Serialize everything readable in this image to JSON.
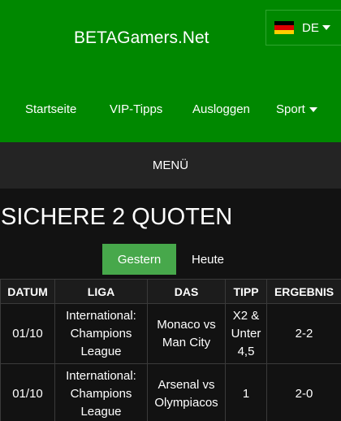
{
  "site": {
    "title": "BETAGamers.Net"
  },
  "language": {
    "code": "DE",
    "flag_colors": [
      "#000000",
      "#dd0000",
      "#ffce00"
    ]
  },
  "nav": {
    "items": [
      "Startseite",
      "VIP-Tipps",
      "Ausloggen",
      "Sport"
    ]
  },
  "menu": {
    "label": "MENÜ"
  },
  "page": {
    "title": "SICHERE 2 QUOTEN"
  },
  "tabs": [
    {
      "label": "Gestern",
      "active": true
    },
    {
      "label": "Heute",
      "active": false
    }
  ],
  "table": {
    "headers": [
      "DATUM",
      "LIGA",
      "DAS",
      "TIPP",
      "ERGEBNIS"
    ],
    "rows": [
      [
        "01/10",
        "International: Champions League",
        "Monaco vs Man City",
        "X2 & Unter 4,5",
        "2-2"
      ],
      [
        "01/10",
        "International: Champions League",
        "Arsenal vs Olympiacos",
        "1",
        "2-0"
      ]
    ]
  },
  "colors": {
    "header_bg": "#008800",
    "active_tab": "#47a84b",
    "menu_bg": "#242424",
    "page_bg": "#121212"
  }
}
